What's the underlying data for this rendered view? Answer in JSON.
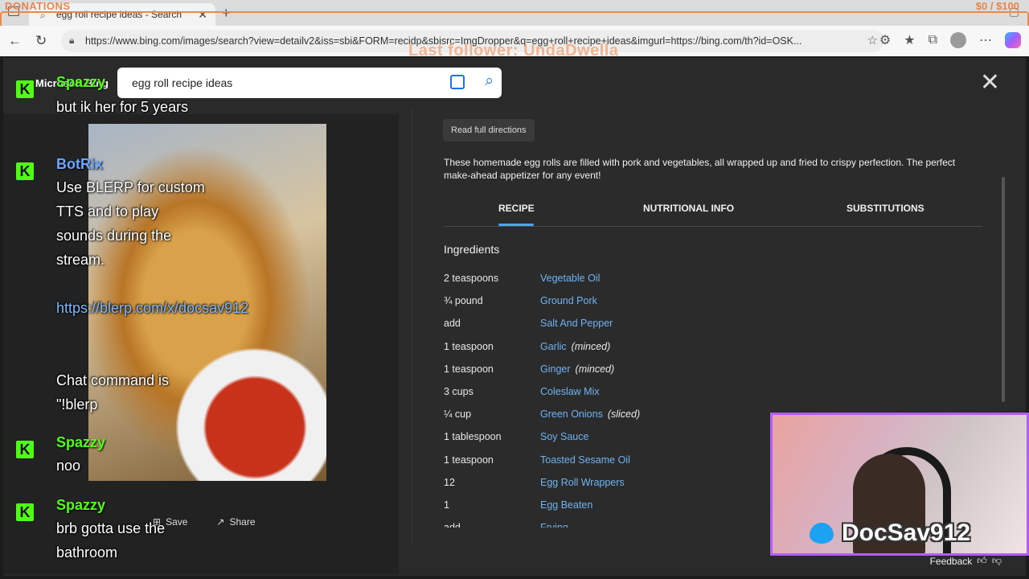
{
  "overlay": {
    "donations_label": "DONATIONS",
    "donation_amount": "$0 / $100",
    "last_follower": "Last follower: UndaDwella"
  },
  "browser": {
    "tab_title": "egg roll recipe ideas - Search",
    "url": "https://www.bing.com/images/search?view=detailv2&iss=sbi&FORM=recidp&sbisrc=ImgDropper&q=egg+roll+recipe+ideas&imgurl=https://bing.com/th?id=OSK..."
  },
  "bing": {
    "logo": "Microsoft Bing",
    "search_value": "egg roll recipe ideas"
  },
  "image_actions": {
    "save": "Save",
    "share": "Share"
  },
  "recipe": {
    "read_full": "Read full directions",
    "description": "These homemade egg rolls are filled with pork and vegetables, all wrapped up and fried to crispy perfection. The perfect make-ahead appetizer for any event!",
    "tabs": [
      "RECIPE",
      "NUTRITIONAL INFO",
      "SUBSTITUTIONS"
    ],
    "ingredients_title": "Ingredients",
    "ingredients": [
      {
        "qty": "2 teaspoons",
        "name": "Vegetable Oil",
        "note": ""
      },
      {
        "qty": "¾ pound",
        "name": "Ground Pork",
        "note": ""
      },
      {
        "qty": "add",
        "name": "Salt And Pepper",
        "note": ""
      },
      {
        "qty": "1 teaspoon",
        "name": "Garlic",
        "note": "(minced)"
      },
      {
        "qty": "1 teaspoon",
        "name": "Ginger",
        "note": "(minced)"
      },
      {
        "qty": "3 cups",
        "name": "Coleslaw Mix",
        "note": ""
      },
      {
        "qty": "¼ cup",
        "name": "Green Onions",
        "note": "(sliced)"
      },
      {
        "qty": "1 tablespoon",
        "name": "Soy Sauce",
        "note": ""
      },
      {
        "qty": "1 teaspoon",
        "name": "Toasted Sesame Oil",
        "note": ""
      },
      {
        "qty": "12",
        "name": "Egg Roll Wrappers",
        "note": ""
      },
      {
        "qty": "1",
        "name": "Egg Beaten",
        "note": ""
      },
      {
        "qty": "add",
        "name": "Frying",
        "note": ""
      }
    ],
    "feedback": "Feedback"
  },
  "chat": [
    {
      "user": "Spazzy",
      "text": "but ik her for 5 years"
    },
    {
      "user": "BotRix",
      "text": "Use BLERP for custom TTS and to play sounds during the stream.",
      "link": "https://blerp.com/x/docsav912",
      "extra": "Chat command is \"!blerp"
    },
    {
      "user": "Spazzy",
      "text": "noo"
    },
    {
      "user": "Spazzy",
      "text": "brb gotta use the bathroom"
    }
  ],
  "webcam": {
    "name": "DocSav912"
  }
}
